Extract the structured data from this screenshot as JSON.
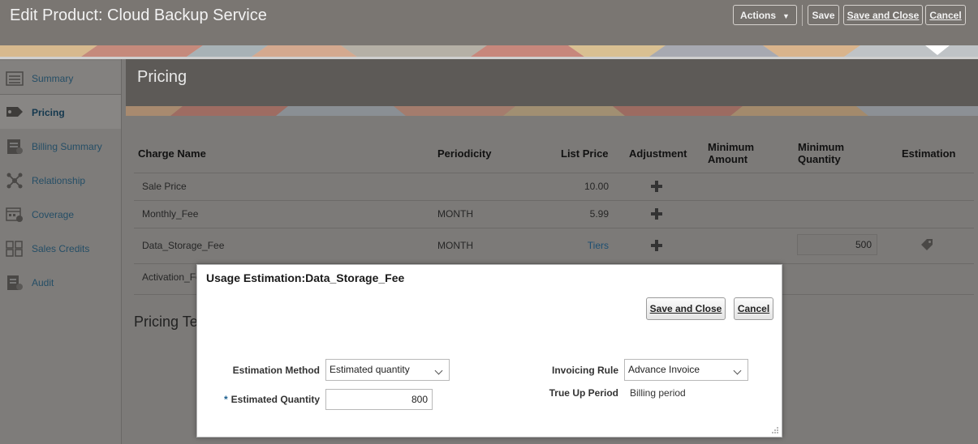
{
  "header": {
    "title": "Edit Product: Cloud Backup Service",
    "actions_label": "Actions",
    "save_label": "Save",
    "save_close_label": "Save and Close",
    "cancel_label": "Cancel"
  },
  "sidebar": {
    "items": [
      {
        "label": "Summary",
        "icon": "list-icon"
      },
      {
        "label": "Pricing",
        "icon": "price-tag-icon"
      },
      {
        "label": "Billing Summary",
        "icon": "invoice-icon"
      },
      {
        "label": "Relationship",
        "icon": "network-icon"
      },
      {
        "label": "Coverage",
        "icon": "calendar-icon"
      },
      {
        "label": "Sales Credits",
        "icon": "grid-icon"
      },
      {
        "label": "Audit",
        "icon": "document-icon"
      }
    ]
  },
  "main": {
    "section_title": "Pricing",
    "columns": {
      "charge_name": "Charge Name",
      "periodicity": "Periodicity",
      "list_price": "List Price",
      "adjustment": "Adjustment",
      "minimum_amount_1": "Minimum",
      "minimum_amount_2": "Amount",
      "minimum_quantity_1": "Minimum",
      "minimum_quantity_2": "Quantity",
      "estimation": "Estimation"
    },
    "rows": [
      {
        "charge_name": "Sale Price",
        "periodicity": "",
        "list_price": "10.00"
      },
      {
        "charge_name": "Monthly_Fee",
        "periodicity": "MONTH",
        "list_price": "5.99"
      },
      {
        "charge_name": "Data_Storage_Fee",
        "periodicity": "MONTH",
        "list_price": "Tiers",
        "minimum_quantity": "500"
      },
      {
        "charge_name": "Activation_Fe",
        "periodicity": "",
        "list_price": ""
      }
    ],
    "pricing_terms_label": "Pricing Te"
  },
  "dialog": {
    "title": "Usage Estimation:Data_Storage_Fee",
    "save_close_label": "Save and Close",
    "cancel_label": "Cancel",
    "estimation_method_label": "Estimation Method",
    "estimation_method_value": "Estimated quantity",
    "estimated_quantity_label": "Estimated Quantity",
    "estimated_quantity_value": "800",
    "required_marker": "*",
    "invoicing_rule_label": "Invoicing Rule",
    "invoicing_rule_value": "Advance Invoice",
    "true_up_label": "True Up Period",
    "true_up_value": "Billing period"
  }
}
